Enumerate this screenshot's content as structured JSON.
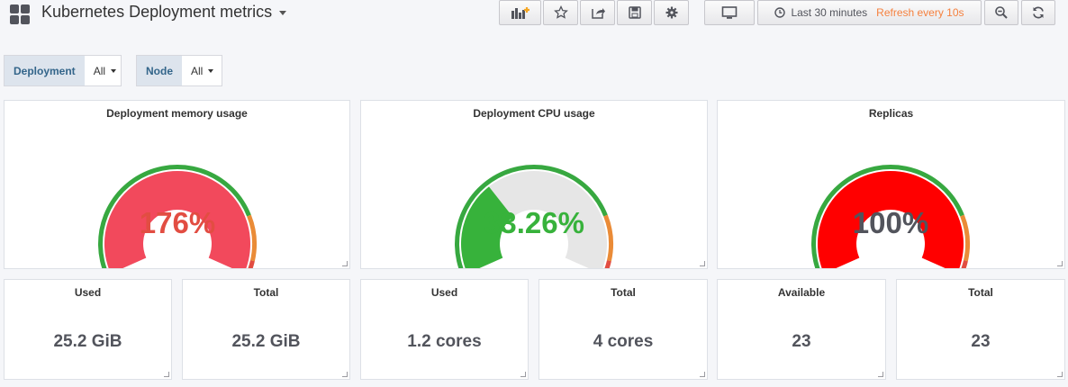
{
  "header": {
    "title": "Kubernetes Deployment metrics",
    "icons": {
      "add_panel": "add-panel-icon",
      "star": "star-icon",
      "share": "share-icon",
      "save": "save-icon",
      "settings": "gear-icon",
      "tv": "monitor-icon",
      "clock": "clock-icon",
      "zoom": "zoom-out-icon",
      "refresh": "refresh-icon"
    },
    "time_range": "Last 30 minutes",
    "refresh_label": "Refresh every 10s"
  },
  "variables": [
    {
      "label": "Deployment",
      "value": "All"
    },
    {
      "label": "Node",
      "value": "All"
    }
  ],
  "gauges": [
    {
      "title": "Deployment memory usage",
      "value_text": "176%",
      "percent": 176,
      "fill_color": "#f2495c",
      "text_color": "#e24d42"
    },
    {
      "title": "Deployment CPU usage",
      "value_text": "33.26%",
      "percent": 33.26,
      "fill_color": "#37b23b",
      "text_color": "#37b23b"
    },
    {
      "title": "Replicas",
      "value_text": "100%",
      "percent": 100,
      "fill_color": "#ff0000",
      "text_color": "#52545c"
    }
  ],
  "threshold_colors": {
    "ok": "#37a840",
    "warn": "#ea8b37",
    "critical": "#e24d42",
    "track": "#e6e6e6"
  },
  "stats": [
    {
      "title": "Used",
      "value": "25.2 GiB"
    },
    {
      "title": "Total",
      "value": "25.2 GiB"
    },
    {
      "title": "Used",
      "value": "1.2 cores"
    },
    {
      "title": "Total",
      "value": "4 cores"
    },
    {
      "title": "Available",
      "value": "23"
    },
    {
      "title": "Total",
      "value": "23"
    }
  ]
}
